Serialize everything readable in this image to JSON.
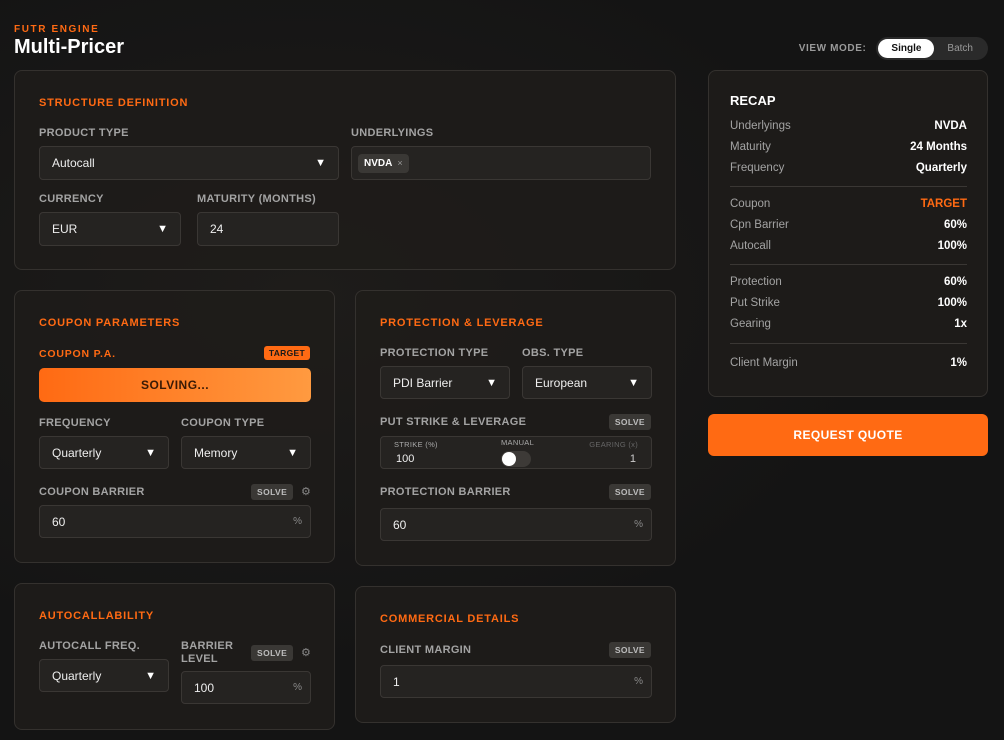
{
  "brand": "FUTR ENGINE",
  "title": "Multi-Pricer",
  "view_mode": {
    "label": "VIEW MODE:",
    "options": [
      "Single",
      "Batch"
    ],
    "selected": "Single"
  },
  "structure": {
    "title": "STRUCTURE DEFINITION",
    "product_type_label": "PRODUCT TYPE",
    "product_type": "Autocall",
    "underlyings_label": "UNDERLYINGS",
    "underlying_chip": "NVDA",
    "chip_remove": "×",
    "currency_label": "CURRENCY",
    "currency": "EUR",
    "maturity_label": "MATURITY (MONTHS)",
    "maturity": "24"
  },
  "coupon": {
    "title": "COUPON PARAMETERS",
    "pa_label": "COUPON P.A.",
    "target_tag": "TARGET",
    "solving": "SOLVING...",
    "frequency_label": "FREQUENCY",
    "frequency": "Quarterly",
    "type_label": "COUPON TYPE",
    "type": "Memory",
    "barrier_label": "COUPON BARRIER",
    "solve": "SOLVE",
    "barrier": "60",
    "unit": "%"
  },
  "protection": {
    "title": "PROTECTION & LEVERAGE",
    "type_label": "PROTECTION TYPE",
    "type": "PDI Barrier",
    "obs_label": "OBS. TYPE",
    "obs": "European",
    "put_label": "PUT STRIKE & LEVERAGE",
    "solve": "SOLVE",
    "strike_label": "STRIKE (%)",
    "strike": "100",
    "manual_label": "MANUAL",
    "gearing_label": "GEARING (x)",
    "gearing": "1",
    "barrier_label": "PROTECTION BARRIER",
    "barrier": "60",
    "unit": "%"
  },
  "autocall": {
    "title": "AUTOCALLABILITY",
    "freq_label": "AUTOCALL FREQ.",
    "freq": "Quarterly",
    "barrier_label_1": "BARRIER",
    "barrier_label_2": "LEVEL",
    "solve": "SOLVE",
    "barrier": "100",
    "unit": "%"
  },
  "commercial": {
    "title": "COMMERCIAL DETAILS",
    "margin_label": "CLIENT MARGIN",
    "solve": "SOLVE",
    "margin": "1",
    "unit": "%"
  },
  "recap": {
    "title": "RECAP",
    "rows": [
      {
        "k": "Underlyings",
        "v": "NVDA"
      },
      {
        "k": "Maturity",
        "v": "24 Months"
      },
      {
        "k": "Frequency",
        "v": "Quarterly"
      },
      {
        "k": "Coupon",
        "v": "TARGET"
      },
      {
        "k": "Cpn Barrier",
        "v": "60%"
      },
      {
        "k": "Autocall",
        "v": "100%"
      },
      {
        "k": "Protection",
        "v": "60%"
      },
      {
        "k": "Put Strike",
        "v": "100%"
      },
      {
        "k": "Gearing",
        "v": "1x"
      },
      {
        "k": "Client Margin",
        "v": "1%"
      }
    ]
  },
  "request_quote": "REQUEST QUOTE",
  "colors": {
    "accent": "#ff6a13",
    "background": "#141414",
    "card": "#1e1c1a"
  },
  "icons": {
    "caret": "caret-down-icon",
    "gear": "gear-icon",
    "remove": "close-icon"
  }
}
